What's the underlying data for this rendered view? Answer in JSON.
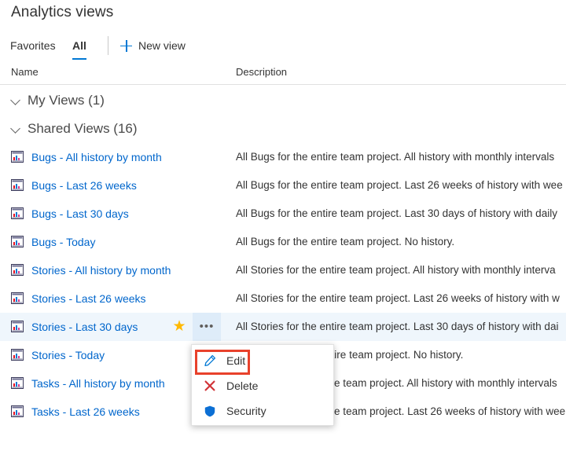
{
  "header": {
    "title": "Analytics views"
  },
  "tabs": [
    {
      "label": "Favorites",
      "name": "tab-favorites",
      "active": false
    },
    {
      "label": "All",
      "name": "tab-all",
      "active": true
    }
  ],
  "command_bar": {
    "new_view_label": "New view",
    "new_view_icon": "plus-icon"
  },
  "columns": {
    "name": "Name",
    "description": "Description"
  },
  "groups": [
    {
      "label": "My Views (1)",
      "icon": "chevron-down-icon",
      "expanded": true
    },
    {
      "label": "Shared Views (16)",
      "icon": "chevron-down-icon",
      "expanded": true
    }
  ],
  "rows": [
    {
      "icon": "chart-report-icon",
      "name": "Bugs - All history by month",
      "description": "All Bugs for the entire team project. All history with monthly intervals",
      "selected": false,
      "favorite": false
    },
    {
      "icon": "chart-report-icon",
      "name": "Bugs - Last 26 weeks",
      "description": "All Bugs for the entire team project. Last 26 weeks of history with wee",
      "selected": false,
      "favorite": false
    },
    {
      "icon": "chart-report-icon",
      "name": "Bugs - Last 30 days",
      "description": "All Bugs for the entire team project. Last 30 days of history with daily",
      "selected": false,
      "favorite": false
    },
    {
      "icon": "chart-report-icon",
      "name": "Bugs - Today",
      "description": "All Bugs for the entire team project. No history.",
      "selected": false,
      "favorite": false
    },
    {
      "icon": "chart-report-icon",
      "name": "Stories - All history by month",
      "description": "All Stories for the entire team project. All history with monthly interva",
      "selected": false,
      "favorite": false
    },
    {
      "icon": "chart-report-icon",
      "name": "Stories - Last 26 weeks",
      "description": "All Stories for the entire team project. Last 26 weeks of history with w",
      "selected": false,
      "favorite": false
    },
    {
      "icon": "chart-report-icon",
      "name": "Stories - Last 30 days",
      "description": "All Stories for the entire team project. Last 30 days of history with dai",
      "selected": true,
      "favorite": true,
      "star_icon": "star-filled-icon",
      "overflow_icon": "ellipsis-icon"
    },
    {
      "icon": "chart-report-icon",
      "name": "Stories - Today",
      "description": "All Stories for the entire team project. No history.",
      "selected": false,
      "favorite": false
    },
    {
      "icon": "chart-report-icon",
      "name": "Tasks - All history by month",
      "description": "All Tasks for the entire team project. All history with monthly intervals",
      "selected": false,
      "favorite": false
    },
    {
      "icon": "chart-report-icon",
      "name": "Tasks - Last 26 weeks",
      "description": "All Tasks for the entire team project. Last 26 weeks of history with wee",
      "selected": false,
      "favorite": false
    }
  ],
  "context_menu": {
    "items": [
      {
        "label": "Edit",
        "icon": "pencil-icon",
        "highlighted": true
      },
      {
        "label": "Delete",
        "icon": "close-x-icon",
        "highlighted": false
      },
      {
        "label": "Security",
        "icon": "shield-icon",
        "highlighted": false
      }
    ]
  },
  "colors": {
    "accent": "#0078d4",
    "link": "#0066cc",
    "selected_row_bg": "#eff6fc",
    "hover_button_bg": "#deecf9",
    "star": "#ffb900",
    "delete": "#d13438",
    "shield": "#0078d4",
    "highlight_border": "#e8412b",
    "text": "#333333"
  }
}
